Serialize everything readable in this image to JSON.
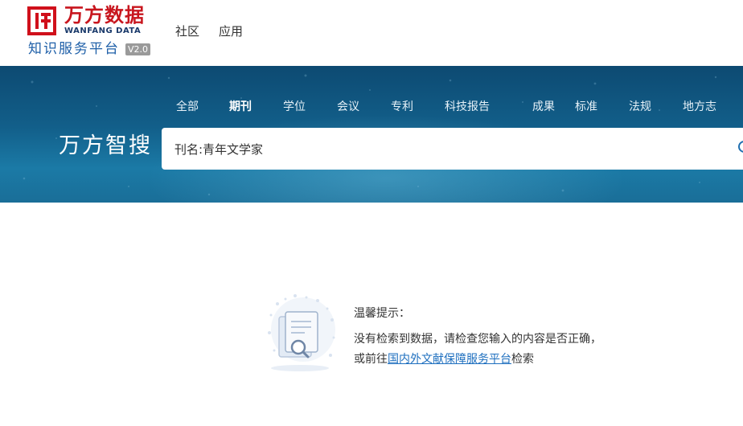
{
  "header": {
    "logo_cn": "万方数据",
    "logo_en": "WANFANG DATA",
    "platform_name": "知识服务平台",
    "version": "V2.0",
    "nav": [
      {
        "label": "社区"
      },
      {
        "label": "应用"
      }
    ]
  },
  "search": {
    "brand": "万方智搜",
    "tabs": [
      {
        "label": "全部",
        "active": false
      },
      {
        "label": "期刊",
        "active": true
      },
      {
        "label": "学位",
        "active": false
      },
      {
        "label": "会议",
        "active": false
      },
      {
        "label": "专利",
        "active": false
      },
      {
        "label": "科技报告",
        "active": false
      },
      {
        "label": "成果",
        "active": false
      },
      {
        "label": "标准",
        "active": false
      },
      {
        "label": "法规",
        "active": false
      },
      {
        "label": "地方志",
        "active": false
      }
    ],
    "query": "刊名:青年文学家"
  },
  "empty_state": {
    "title": "温馨提示：",
    "line1": "没有检索到数据，请检查您输入的内容是否正确，",
    "line2_prefix": "或前往",
    "line2_link": "国内外文献保障服务平台",
    "line2_suffix": "检索"
  },
  "colors": {
    "brand_red": "#c8161e",
    "platform_blue": "#1e5fa8",
    "banner_blue": "#125f8a",
    "link_blue": "#1e6fbf"
  }
}
